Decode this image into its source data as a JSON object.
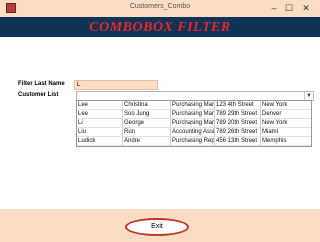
{
  "window": {
    "title": "Customers_Combo",
    "minimize": "–",
    "maximize": "☐",
    "close": "✕"
  },
  "header": {
    "title": "COMBOBOX FILTER"
  },
  "form": {
    "filter_label": "Filter Last Name",
    "filter_value": "L",
    "list_label": "Customer List",
    "combo_value": ""
  },
  "dropdown_rows": [
    [
      "Lee",
      "Christina",
      "Purchasing Man",
      "123 4th Street",
      "New York"
    ],
    [
      "Lee",
      "Soo Jung",
      "Purchasing Man",
      "789 29th Street",
      "Denver"
    ],
    [
      "Li",
      "George",
      "Purchasing Man",
      "789 20th Street",
      "New York"
    ],
    [
      "Liu",
      "Run",
      "Accounting Assi",
      "789 26th Street",
      "Miami"
    ],
    [
      "Ludick",
      "Andre",
      "Purchasing Repi",
      "456 13th Street",
      "Memphis"
    ]
  ],
  "buttons": {
    "exit": "Exit"
  },
  "colors": {
    "header_bg": "#0d3355",
    "title_red": "#e8272b",
    "peach": "#fbdcc4"
  }
}
